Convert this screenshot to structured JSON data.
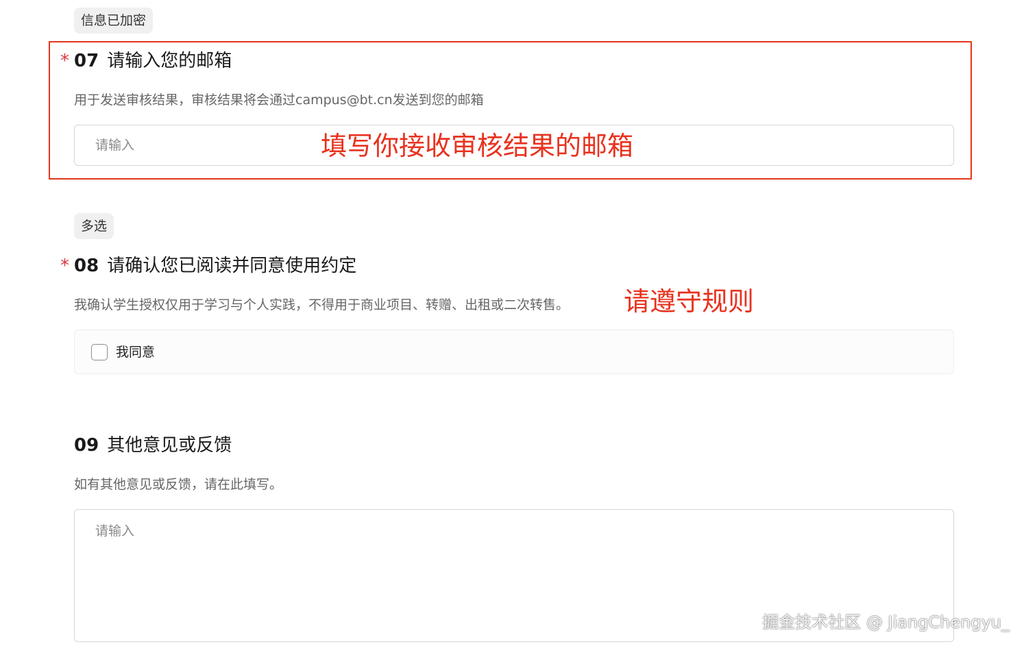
{
  "q07": {
    "tag": "信息已加密",
    "required_mark": "*",
    "number": "07",
    "title": "请输入您的邮箱",
    "description": "用于发送审核结果，审核结果将会通过campus@bt.cn发送到您的邮箱",
    "input_placeholder": "请输入",
    "annotation": "填写你接收审核结果的邮箱",
    "highlight_color": "#e2361b"
  },
  "q08": {
    "tag": "多选",
    "required_mark": "*",
    "number": "08",
    "title": "请确认您已阅读并同意使用约定",
    "description": "我确认学生授权仅用于学习与个人实践，不得用于商业项目、转赠、出租或二次转售。",
    "annotation": "请遵守规则",
    "option_label": "我同意",
    "option_checked": false
  },
  "q09": {
    "number": "09",
    "title": "其他意见或反馈",
    "description": "如有其他意见或反馈，请在此填写。",
    "input_placeholder": "请输入"
  },
  "watermark": "掘金技术社区 @ JiangChengyu_",
  "colors": {
    "required": "#d9363e",
    "annotation": "#e8321e",
    "tag_bg": "#f0f0f0"
  }
}
